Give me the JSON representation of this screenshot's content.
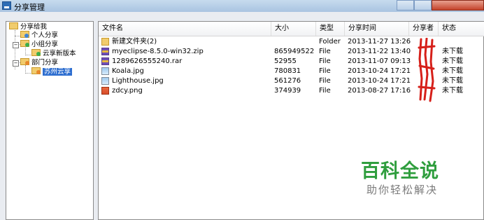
{
  "window": {
    "title": "分享管理"
  },
  "tree": {
    "root": "分享给我",
    "items": [
      {
        "label": "个人分享"
      },
      {
        "label": "小组分享"
      },
      {
        "label": "云享新版本"
      },
      {
        "label": "部门分享"
      },
      {
        "label": "苏州云享"
      }
    ]
  },
  "table": {
    "headers": [
      "文件名",
      "大小",
      "类型",
      "分享时间",
      "分享者",
      "状态"
    ],
    "rows": [
      {
        "name": "新建文件夹(2)",
        "size": "",
        "type": "Folder",
        "time": "2013-11-27 13:26",
        "sharer": "",
        "status": "",
        "icon": "folder-icon"
      },
      {
        "name": "myeclipse-8.5.0-win32.zip",
        "size": "865949522",
        "type": "File",
        "time": "2013-11-22 13:40",
        "sharer": "",
        "status": "未下载",
        "icon": "archive-icon"
      },
      {
        "name": "1289626555240.rar",
        "size": "52955",
        "type": "File",
        "time": "2013-11-07 09:13",
        "sharer": "",
        "status": "未下载",
        "icon": "archive-icon"
      },
      {
        "name": "Koala.jpg",
        "size": "780831",
        "type": "File",
        "time": "2013-10-24 17:21",
        "sharer": "",
        "status": "未下载",
        "icon": "image-icon"
      },
      {
        "name": "Lighthouse.jpg",
        "size": "561276",
        "type": "File",
        "time": "2013-10-24 17:21",
        "sharer": "",
        "status": "未下载",
        "icon": "image-icon"
      },
      {
        "name": "zdcy.png",
        "size": "374939",
        "type": "File",
        "time": "2013-08-27 17:16",
        "sharer": "",
        "status": "未下载",
        "icon": "png-icon"
      }
    ]
  },
  "watermark": {
    "title": "百科全说",
    "subtitle": "助你轻松解决"
  },
  "colors": {
    "selection": "#2f6fd0",
    "watermark": "#2f9e3e",
    "redact": "#d6201a"
  }
}
